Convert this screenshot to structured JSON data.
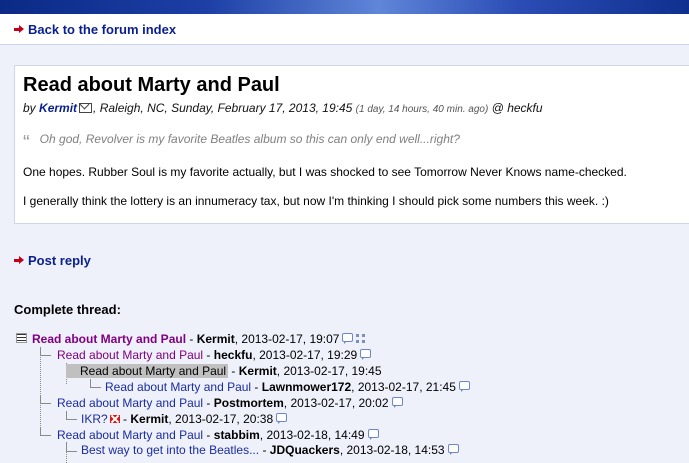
{
  "nav": {
    "back_label": "Back to the forum index"
  },
  "message": {
    "title": "Read about Marty and Paul",
    "by_prefix": "by",
    "author": "Kermit",
    "location_date": ", Raleigh, NC, Sunday, February 17, 2013, 19:45",
    "ago": "(1 day, 14 hours, 40 min. ago)",
    "reply_to": "@ heckfu",
    "quote": "Oh god, Revolver is my favorite Beatles album so this can only end well...right?",
    "body": [
      "One hopes. Rubber Soul is my favorite actually, but I was shocked to see Tomorrow Never Knows name-checked.",
      "I generally think the lottery is an innumeracy tax, but now I'm thinking I should pick some numbers this week. :)"
    ]
  },
  "actions": {
    "post_reply": "Post reply"
  },
  "thread": {
    "heading": "Complete thread:",
    "rows": [
      {
        "subject": "Read about Marty and Paul",
        "author": "Kermit",
        "date": "2013-02-17, 19:07"
      },
      {
        "subject": "Read about Marty and Paul",
        "author": "heckfu",
        "date": "2013-02-17, 19:29"
      },
      {
        "subject": "Read about Marty and Paul",
        "author": "Kermit",
        "date": "2013-02-17, 19:45"
      },
      {
        "subject": "Read about Marty and Paul",
        "author": "Lawnmower172",
        "date": "2013-02-17, 21:45"
      },
      {
        "subject": "Read about Marty and Paul",
        "author": "Postmortem",
        "date": "2013-02-17, 20:02"
      },
      {
        "subject": "IKR?",
        "author": "Kermit",
        "date": "2013-02-17, 20:38"
      },
      {
        "subject": "Read about Marty and Paul",
        "author": "stabbim",
        "date": "2013-02-18, 14:49"
      },
      {
        "subject": "Best way to get into the Beatles...",
        "author": "JDQuackers",
        "date": "2013-02-18, 14:53"
      }
    ],
    "separator": " - "
  }
}
